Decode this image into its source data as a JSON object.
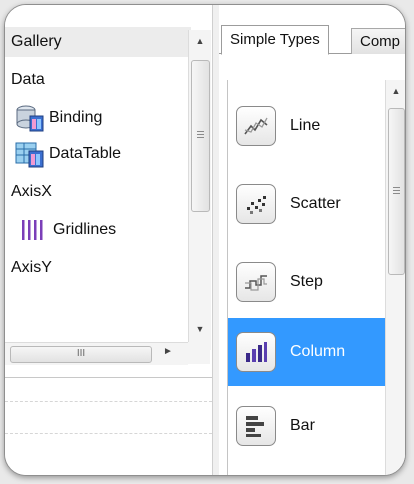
{
  "tree": {
    "items": [
      {
        "label": "Gallery",
        "selected": true,
        "indent": false,
        "icon": ""
      },
      {
        "label": "Data",
        "selected": false,
        "indent": false,
        "icon": ""
      },
      {
        "label": "Binding",
        "selected": false,
        "indent": true,
        "icon": "database-binding-icon"
      },
      {
        "label": "DataTable",
        "selected": false,
        "indent": true,
        "icon": "data-table-icon"
      },
      {
        "label": "AxisX",
        "selected": false,
        "indent": false,
        "icon": ""
      },
      {
        "label": "Gridlines",
        "selected": false,
        "indent": true,
        "icon": "gridlines-icon"
      },
      {
        "label": "AxisY",
        "selected": false,
        "indent": false,
        "icon": ""
      }
    ],
    "hscroll_grip": "III"
  },
  "tabs": [
    {
      "label": "Simple Types",
      "active": true
    },
    {
      "label": "Comp",
      "active": false
    }
  ],
  "chart_types": [
    {
      "label": "Line",
      "selected": false,
      "icon": "line-chart-icon"
    },
    {
      "label": "Scatter",
      "selected": false,
      "icon": "scatter-chart-icon"
    },
    {
      "label": "Step",
      "selected": false,
      "icon": "step-chart-icon"
    },
    {
      "label": "Column",
      "selected": true,
      "icon": "column-chart-icon"
    },
    {
      "label": "Bar",
      "selected": false,
      "icon": "bar-chart-icon"
    }
  ],
  "colors": {
    "selection": "#3399ff",
    "gridlines_icon": "#7b3fb8"
  }
}
